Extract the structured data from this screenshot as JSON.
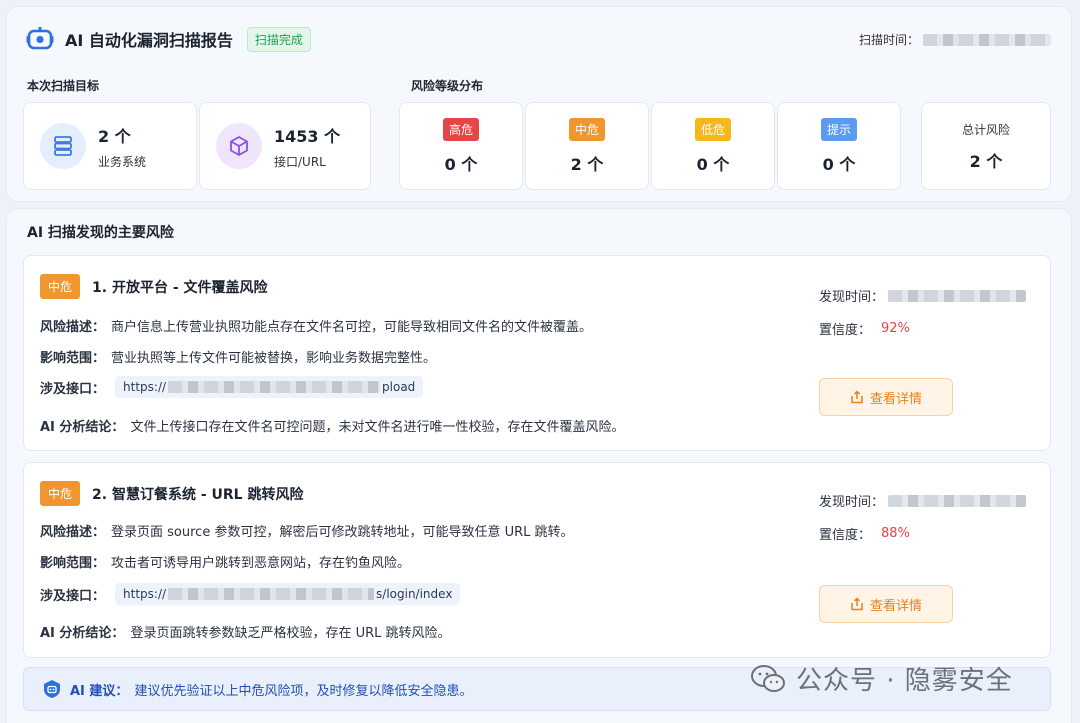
{
  "header": {
    "title": "AI 自动化漏洞扫描报告",
    "status": "扫描完成",
    "scan_time_label": "扫描时间：",
    "logo_icon": "robot-icon"
  },
  "targets": {
    "section_label": "本次扫描目标",
    "items": [
      {
        "count": "2 个",
        "label": "业务系统",
        "icon": "server-icon",
        "color": "#3b7be6"
      },
      {
        "count": "1453 个",
        "label": "接口/URL",
        "icon": "cube-icon",
        "color": "#8b52e0"
      }
    ]
  },
  "risk_distribution": {
    "section_label": "风险等级分布",
    "levels": [
      {
        "label": "高危",
        "count": "0 个",
        "color": "#e64545"
      },
      {
        "label": "中危",
        "count": "2 个",
        "color": "#f0962e"
      },
      {
        "label": "低危",
        "count": "0 个",
        "color": "#f2b81c"
      },
      {
        "label": "提示",
        "count": "0 个",
        "color": "#5a9bf0"
      }
    ],
    "total_label": "总计风险",
    "total_count": "2 个"
  },
  "findings": {
    "section_title": "AI 扫描发现的主要风险",
    "items": [
      {
        "level": "中危",
        "title": "1. 开放平台 - 文件覆盖风险",
        "desc_key": "风险描述：",
        "desc": "商户信息上传营业执照功能点存在文件名可控，可能导致相同文件名的文件被覆盖。",
        "scope_key": "影响范围：",
        "scope": "营业执照等上传文件可能被替换，影响业务数据完整性。",
        "api_key": "涉及接口：",
        "api_prefix": "https://",
        "api_suffix": "pload",
        "conclusion_key": "AI 分析结论：",
        "conclusion": "文件上传接口存在文件名可控问题，未对文件名进行唯一性校验，存在文件覆盖风险。",
        "found_time_label": "发现时间：",
        "confidence_label": "置信度：",
        "confidence": "92%",
        "detail_button": "查看详情"
      },
      {
        "level": "中危",
        "title": "2. 智慧订餐系统 - URL 跳转风险",
        "desc_key": "风险描述：",
        "desc": "登录页面 source 参数可控，解密后可修改跳转地址，可能导致任意 URL 跳转。",
        "scope_key": "影响范围：",
        "scope": "攻击者可诱导用户跳转到恶意网站，存在钓鱼风险。",
        "api_key": "涉及接口：",
        "api_prefix": "https://",
        "api_suffix": "s/login/index",
        "conclusion_key": "AI 分析结论：",
        "conclusion": "登录页面跳转参数缺乏严格校验，存在 URL 跳转风险。",
        "found_time_label": "发现时间：",
        "confidence_label": "置信度：",
        "confidence": "88%",
        "detail_button": "查看详情"
      }
    ]
  },
  "advice": {
    "key": "AI 建议：",
    "text": "建议优先验证以上中危风险项，及时修复以降低安全隐患。"
  },
  "watermark": {
    "text": "公众号 · 隐雾安全"
  }
}
